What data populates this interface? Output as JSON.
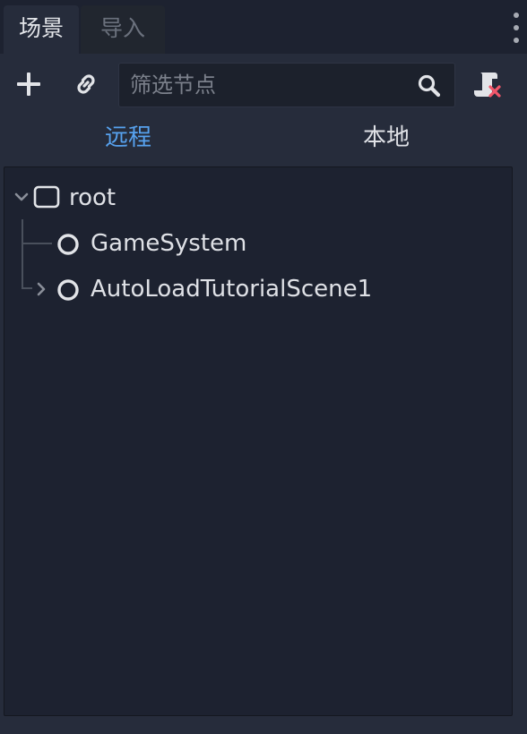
{
  "tabs": [
    {
      "label": "场景",
      "active": true
    },
    {
      "label": "导入",
      "active": false
    }
  ],
  "toolbar": {
    "filter": {
      "placeholder": "筛选节点",
      "value": ""
    },
    "icons": {
      "add": "plus-icon",
      "link": "link-icon",
      "search": "search-icon",
      "script": "script-detach-icon"
    }
  },
  "subtabs": [
    {
      "label": "远程",
      "active": true
    },
    {
      "label": "本地",
      "active": false
    }
  ],
  "tree": {
    "root": {
      "label": "root",
      "icon": "node-square-icon",
      "expanded": true
    },
    "children": [
      {
        "label": "GameSystem",
        "icon": "node-circle-icon",
        "expandable": false
      },
      {
        "label": "AutoLoadTutorialScene1",
        "icon": "node-circle-icon",
        "expandable": true
      }
    ]
  },
  "colors": {
    "accent": "#57a2ef",
    "panel": "#262c3b",
    "background": "#1d2230",
    "error": "#f2576b"
  }
}
